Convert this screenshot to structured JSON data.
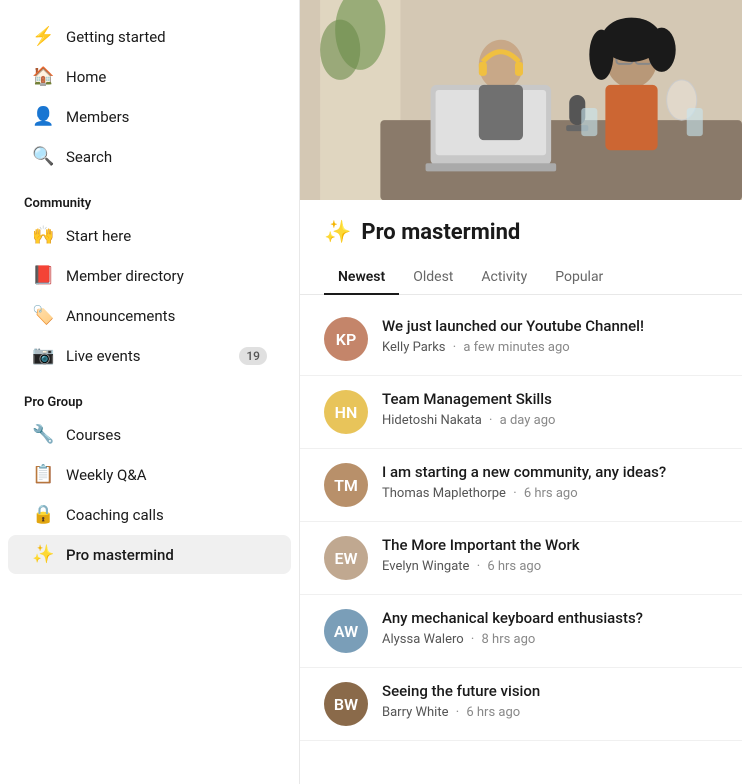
{
  "sidebar": {
    "top_nav": [
      {
        "id": "getting-started",
        "label": "Getting started",
        "icon": "⚡"
      },
      {
        "id": "home",
        "label": "Home",
        "icon": "🏠"
      },
      {
        "id": "members",
        "label": "Members",
        "icon": "👤"
      },
      {
        "id": "search",
        "label": "Search",
        "icon": "🔍"
      }
    ],
    "community_section_label": "Community",
    "community_nav": [
      {
        "id": "start-here",
        "label": "Start here",
        "icon": "🙌"
      },
      {
        "id": "member-directory",
        "label": "Member directory",
        "icon": "📕"
      },
      {
        "id": "announcements",
        "label": "Announcements",
        "icon": "🏷️"
      },
      {
        "id": "live-events",
        "label": "Live events",
        "icon": "📷",
        "badge": "19"
      }
    ],
    "progroup_section_label": "Pro Group",
    "progroup_nav": [
      {
        "id": "courses",
        "label": "Courses",
        "icon": "🔧"
      },
      {
        "id": "weekly-qa",
        "label": "Weekly Q&A",
        "icon": "📋"
      },
      {
        "id": "coaching-calls",
        "label": "Coaching calls",
        "icon": "🔒"
      },
      {
        "id": "pro-mastermind",
        "label": "Pro mastermind",
        "icon": "✨",
        "active": true
      }
    ]
  },
  "main": {
    "community_icon": "✨",
    "community_title": "Pro mastermind",
    "tabs": [
      {
        "id": "newest",
        "label": "Newest",
        "active": true
      },
      {
        "id": "oldest",
        "label": "Oldest",
        "active": false
      },
      {
        "id": "activity",
        "label": "Activity",
        "active": false
      },
      {
        "id": "popular",
        "label": "Popular",
        "active": false
      }
    ],
    "posts": [
      {
        "id": "post-1",
        "title": "We just launched our Youtube Channel!",
        "author": "Kelly Parks",
        "time": "a few minutes ago",
        "avatar_color": "#c4856a",
        "avatar_initials": "KP"
      },
      {
        "id": "post-2",
        "title": "Team Management Skills",
        "author": "Hidetoshi Nakata",
        "time": "a day ago",
        "avatar_color": "#e8c45a",
        "avatar_initials": "HN"
      },
      {
        "id": "post-3",
        "title": "I am starting a new community, any ideas?",
        "author": "Thomas Maplethorpe",
        "time": "6 hrs ago",
        "avatar_color": "#b8906a",
        "avatar_initials": "TM"
      },
      {
        "id": "post-4",
        "title": "The More Important the Work",
        "author": "Evelyn Wingate",
        "time": "6 hrs ago",
        "avatar_color": "#c0a890",
        "avatar_initials": "EW"
      },
      {
        "id": "post-5",
        "title": "Any mechanical keyboard enthusiasts?",
        "author": "Alyssa Walero",
        "time": "8 hrs ago",
        "avatar_color": "#7a9eb8",
        "avatar_initials": "AW"
      },
      {
        "id": "post-6",
        "title": "Seeing the future vision",
        "author": "Barry White",
        "time": "6 hrs ago",
        "avatar_color": "#8a6a4a",
        "avatar_initials": "BW"
      }
    ]
  }
}
